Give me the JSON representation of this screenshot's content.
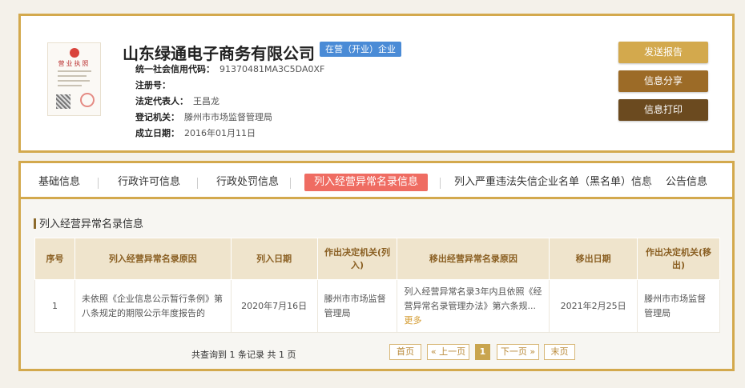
{
  "company": {
    "name": "山东绿通电子商务有限公司",
    "status": "在营（开业）企业",
    "license_title": "营业执照",
    "fields": [
      {
        "label": "统一社会信用代码：",
        "value": "91370481MA3C5DA0XF"
      },
      {
        "label": "注册号：",
        "value": ""
      },
      {
        "label": "法定代表人：",
        "value": "王昌龙"
      },
      {
        "label": "登记机关：",
        "value": "滕州市市场监督管理局"
      },
      {
        "label": "成立日期：",
        "value": "2016年01月11日"
      }
    ]
  },
  "actions": {
    "report": "发送报告",
    "share": "信息分享",
    "print": "信息打印"
  },
  "tabs": [
    {
      "label": "基础信息"
    },
    {
      "label": "行政许可信息"
    },
    {
      "label": "行政处罚信息"
    },
    {
      "label": "列入经营异常名录信息",
      "active": true
    },
    {
      "label": "列入严重违法失信企业名单（黑名单）信息"
    },
    {
      "label": "公告信息"
    }
  ],
  "section_title": "列入经营异常名录信息",
  "table": {
    "headers": [
      "序号",
      "列入经营异常名录原因",
      "列入日期",
      "作出决定机关(列入)",
      "移出经营异常名录原因",
      "移出日期",
      "作出决定机关(移出)"
    ],
    "rows": [
      {
        "no": "1",
        "reason_in": "未依照《企业信息公示暂行条例》第八条规定的期限公示年度报告的",
        "date_in": "2020年7月16日",
        "org_in": "滕州市市场监督管理局",
        "reason_out": "列入经营异常名录3年内且依照《经营异常名录管理办法》第六条规...",
        "more": "更多",
        "date_out": "2021年2月25日",
        "org_out": "滕州市市场监督管理局"
      }
    ]
  },
  "pager": {
    "info": "共查询到 1 条记录 共 1 页",
    "first": "首页",
    "prev": "« 上一页",
    "current": "1",
    "next": "下一页 »",
    "last": "末页"
  },
  "colors": {
    "gold_border": "#d3a94d",
    "status_blue": "#4a8bd6",
    "active_tab": "#ef6c62",
    "header_bg": "#efe4cc"
  }
}
